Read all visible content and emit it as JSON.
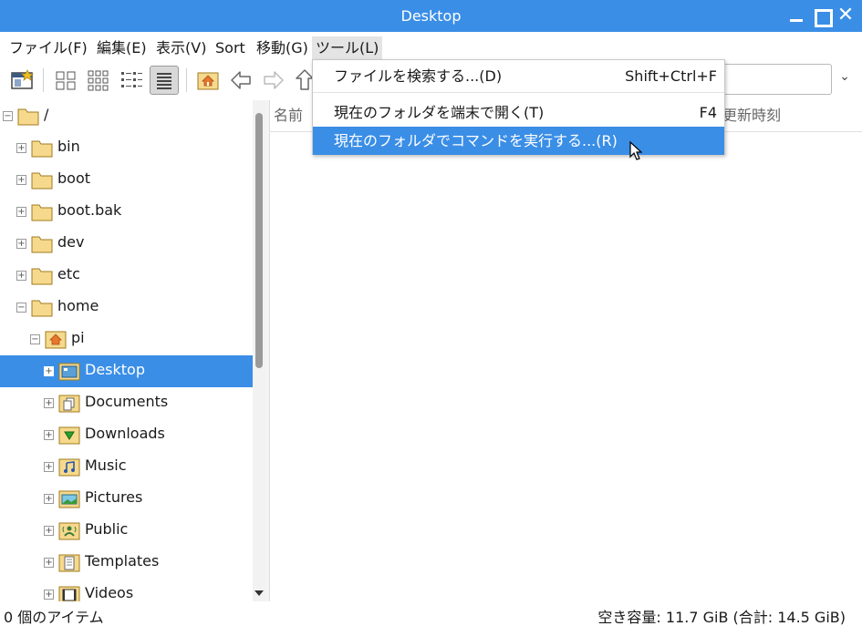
{
  "window": {
    "title": "Desktop"
  },
  "menubar": {
    "items": [
      "ファイル(F)",
      "編集(E)",
      "表示(V)",
      "Sort",
      "移動(G)",
      "ツール(L)"
    ]
  },
  "tools_menu": {
    "items": [
      {
        "label": "ファイルを検索する...(D)",
        "accel": "Shift+Ctrl+F"
      },
      {
        "label": "現在のフォルダを端末で開く(T)",
        "accel": "F4"
      },
      {
        "label": "現在のフォルダでコマンドを実行する...(R)",
        "accel": ""
      }
    ]
  },
  "file_list": {
    "columns": [
      "名前",
      "更新時刻"
    ]
  },
  "tree": {
    "root": "/",
    "items": [
      "bin",
      "boot",
      "boot.bak",
      "dev",
      "etc",
      "home",
      "pi",
      "Desktop",
      "Documents",
      "Downloads",
      "Music",
      "Pictures",
      "Public",
      "Templates",
      "Videos"
    ],
    "selected": "Desktop"
  },
  "statusbar": {
    "left": "0 個のアイテム",
    "right": "空き容量: 11.7 GiB (合計: 14.5 GiB)"
  },
  "colors": {
    "accent": "#3a8ee6",
    "folder": "#f6d98c"
  }
}
